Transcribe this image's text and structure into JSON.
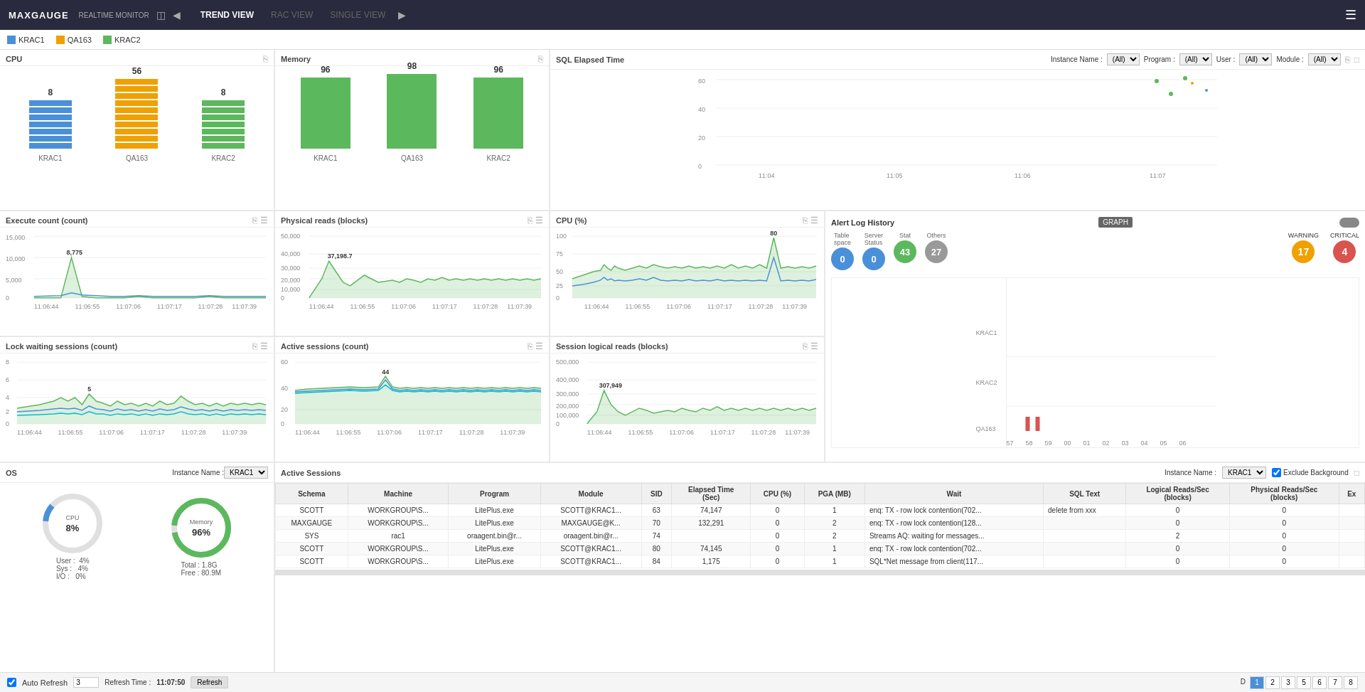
{
  "header": {
    "brand": "MAXGAUGE",
    "sub": "REALTIME MONITOR",
    "nav": [
      {
        "label": "TREND VIEW",
        "active": true
      },
      {
        "label": "RAC VIEW",
        "active": false
      },
      {
        "label": "SINGLE VIEW",
        "active": false
      }
    ]
  },
  "legend": [
    {
      "label": "KRAC1",
      "color": "#4a90d9"
    },
    {
      "label": "QA163",
      "color": "#f0a000"
    },
    {
      "label": "KRAC2",
      "color": "#5cb85c"
    }
  ],
  "panels": {
    "cpu": {
      "title": "CPU",
      "instances": [
        {
          "name": "KRAC1",
          "value": 8
        },
        {
          "name": "QA163",
          "value": 56
        },
        {
          "name": "KRAC2",
          "value": 8
        }
      ]
    },
    "memory": {
      "title": "Memory",
      "instances": [
        {
          "name": "KRAC1",
          "value": 96
        },
        {
          "name": "QA163",
          "value": 98
        },
        {
          "name": "KRAC2",
          "value": 96
        }
      ]
    },
    "sql_elapsed": {
      "title": "SQL Elapsed Time",
      "controls": {
        "instance_label": "Instance Name :",
        "instance_val": "(All)",
        "program_label": "Program :",
        "program_val": "(All)",
        "user_label": "User :",
        "user_val": "(All)",
        "module_label": "Module :",
        "module_val": "(All)"
      },
      "y_axis": [
        60,
        40,
        20,
        0
      ],
      "x_axis": [
        "11:04",
        "11:05",
        "11:06",
        "11:07"
      ]
    },
    "execute_count": {
      "title": "Execute count (count)",
      "y_axis": [
        "15,000",
        "10,000",
        "5,000",
        "0"
      ],
      "peak": "8,775",
      "x_axis": [
        "11:06:44",
        "11:06:55",
        "11:07:06",
        "11:07:17",
        "11:07:28",
        "11:07:39"
      ]
    },
    "physical_reads": {
      "title": "Physical reads (blocks)",
      "y_axis": [
        "50,000",
        "40,000",
        "30,000",
        "20,000",
        "10,000",
        "0"
      ],
      "peak": "37,198.7",
      "x_axis": [
        "11:06:44",
        "11:06:55",
        "11:07:06",
        "11:07:17",
        "11:07:28",
        "11:07:39"
      ]
    },
    "cpu_pct": {
      "title": "CPU (%)",
      "y_axis": [
        100,
        75,
        50,
        25,
        0
      ],
      "peak": "80",
      "x_axis": [
        "11:06:44",
        "11:06:55",
        "11:07:06",
        "11:07:17",
        "11:07:28",
        "11:07:39"
      ]
    },
    "alert_log": {
      "title": "Alert Log History",
      "graph_btn": "GRAPH",
      "metrics": [
        {
          "label": "Table space",
          "value": "0",
          "color": "blue"
        },
        {
          "label": "Server Status",
          "value": "0",
          "color": "blue"
        },
        {
          "label": "Stat",
          "value": "43",
          "color": "green"
        },
        {
          "label": "Others",
          "value": "27",
          "color": "gray"
        }
      ],
      "warning_label": "WARNING",
      "warning_value": "17",
      "critical_label": "CRITICAL",
      "critical_value": "4",
      "rows": [
        "KRAC1",
        "KRAC2",
        "QA163"
      ],
      "x_axis": [
        "57",
        "58",
        "59",
        "00",
        "01",
        "02",
        "03",
        "04",
        "05",
        "06"
      ]
    },
    "lock_waiting": {
      "title": "Lock waiting sessions (count)",
      "y_axis": [
        8,
        6,
        4,
        2,
        0
      ],
      "peak": "5",
      "x_axis": [
        "11:06:44",
        "11:06:55",
        "11:07:06",
        "11:07:17",
        "11:07:28",
        "11:07:39"
      ]
    },
    "active_sessions": {
      "title": "Active sessions (count)",
      "y_axis": [
        60,
        40,
        20,
        0
      ],
      "peak": "44",
      "x_axis": [
        "11:06:44",
        "11:06:55",
        "11:07:06",
        "11:07:17",
        "11:07:28",
        "11:07:39"
      ]
    },
    "session_logical": {
      "title": "Session logical reads (blocks)",
      "y_axis": [
        "500,000",
        "400,000",
        "300,000",
        "200,000",
        "100,000",
        "0"
      ],
      "peak": "307,949",
      "x_axis": [
        "11:06:44",
        "11:06:55",
        "11:07:06",
        "11:07:17",
        "11:07:28",
        "11:07:39"
      ]
    },
    "os": {
      "title": "OS",
      "instance_label": "Instance Name :",
      "instance_val": "KRAC1",
      "cpu_label": "CPU",
      "cpu_pct": "8%",
      "cpu_user": "4%",
      "cpu_sys": "4%",
      "cpu_io": "0%",
      "memory_label": "Memory",
      "memory_pct": "96%",
      "memory_total": "1.8G",
      "memory_free": "80.9M"
    }
  },
  "active_sessions_table": {
    "title": "Active Sessions",
    "instance_label": "Instance Name :",
    "instance_val": "KRAC1",
    "exclude_bg": "Exclude Background",
    "columns": [
      "Schema",
      "Machine",
      "Program",
      "Module",
      "SID",
      "Elapsed Time (Sec)",
      "CPU (%)",
      "PGA (MB)",
      "Wait",
      "SQL Text",
      "Logical Reads/Sec (blocks)",
      "Physical Reads/Sec (blocks)",
      "Ex"
    ],
    "rows": [
      {
        "schema": "SCOTT",
        "machine": "WORKGROUP\\S...",
        "program": "LitePlus.exe",
        "module": "SCOTT@KRAC1...",
        "sid": 63,
        "elapsed": "74,147",
        "cpu": 0,
        "pga": 1,
        "wait": "enq: TX - row lock contention(702...",
        "sql_text": "delete from xxx",
        "logical": 0,
        "physical": 0,
        "ex": ""
      },
      {
        "schema": "MAXGAUGE",
        "machine": "WORKGROUP\\S...",
        "program": "LitePlus.exe",
        "module": "MAXGAUGE@K...",
        "sid": 70,
        "elapsed": "132,291",
        "cpu": 0,
        "pga": 2,
        "wait": "enq: TX - row lock contention(128...",
        "sql_text": "",
        "logical": 0,
        "physical": 0,
        "ex": ""
      },
      {
        "schema": "SYS",
        "machine": "rac1",
        "program": "oraagent.bin@r...",
        "module": "oraagent.bin@r...",
        "sid": 74,
        "elapsed": "",
        "cpu": 0,
        "pga": 2,
        "wait": "Streams AQ: waiting for messages...",
        "sql_text": "",
        "logical": 2,
        "physical": 0,
        "ex": ""
      },
      {
        "schema": "SCOTT",
        "machine": "WORKGROUP\\S...",
        "program": "LitePlus.exe",
        "module": "SCOTT@KRAC1...",
        "sid": 80,
        "elapsed": "74,145",
        "cpu": 0,
        "pga": 1,
        "wait": "enq: TX - row lock contention(702...",
        "sql_text": "",
        "logical": 0,
        "physical": 0,
        "ex": ""
      },
      {
        "schema": "SCOTT",
        "machine": "WORKGROUP\\S...",
        "program": "LitePlus.exe",
        "module": "SCOTT@KRAC1...",
        "sid": 84,
        "elapsed": "1,175",
        "cpu": 0,
        "pga": 1,
        "wait": "SQL*Net message from client(117...",
        "sql_text": "",
        "logical": 0,
        "physical": 0,
        "ex": ""
      }
    ]
  },
  "bottom_bar": {
    "auto_refresh_label": "Auto Refresh",
    "refresh_count": "3",
    "refresh_time_label": "Refresh Time :",
    "refresh_time": "11:07:50",
    "refresh_btn": "Refresh",
    "page_label": "D",
    "pages": [
      "1",
      "2",
      "3",
      "5",
      "6",
      "7",
      "8"
    ]
  }
}
